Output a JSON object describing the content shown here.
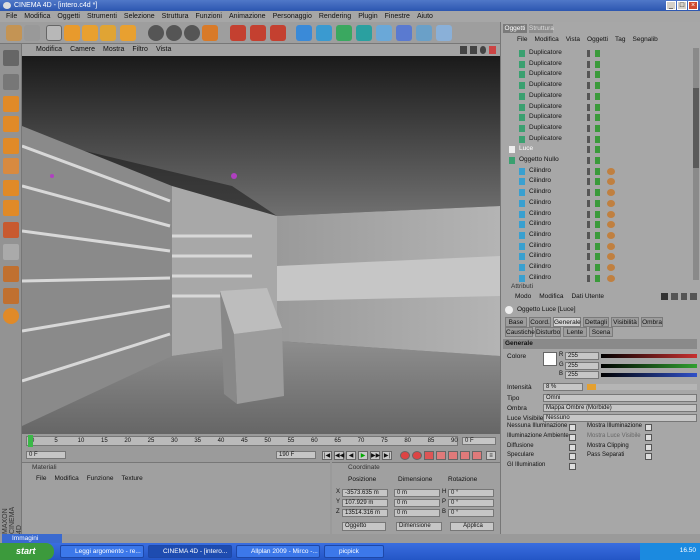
{
  "window": {
    "title": "CINEMA 4D - [intero.c4d *]"
  },
  "menu": [
    "File",
    "Modifica",
    "Oggetti",
    "Strumenti",
    "Selezione",
    "Struttura",
    "Funzioni",
    "Animazione",
    "Personaggio",
    "Rendering",
    "Plugin",
    "Finestre",
    "Aiuto"
  ],
  "viewport_menu": [
    "Modifica",
    "Camere",
    "Mostra",
    "Filtro",
    "Vista"
  ],
  "object_manager": {
    "tabs": [
      "Oggetti",
      "Struttura"
    ],
    "menu": [
      "File",
      "Modifica",
      "Vista",
      "Oggetti",
      "Tag",
      "Segnalib"
    ],
    "rows": [
      "Duplicatore",
      "Duplicatore",
      "Duplicatore",
      "Duplicatore",
      "Duplicatore",
      "Duplicatore",
      "Duplicatore",
      "Duplicatore",
      "Duplicatore",
      "Luce",
      "Oggetto Nullo",
      "Cilindro",
      "Cilindro",
      "Cilindro",
      "Cilindro",
      "Cilindro",
      "Cilindro",
      "Cilindro",
      "Cilindro",
      "Cilindro",
      "Cilindro",
      "Cilindro"
    ]
  },
  "attributes": {
    "tab": "Attributi",
    "menu": [
      "Modo",
      "Modifica",
      "Dati Utente"
    ],
    "object_name": "Oggetto Luce [Luce]",
    "tabs_row1": [
      "Base",
      "Coord.",
      "Generale",
      "Dettagli",
      "Visibilità",
      "Ombra"
    ],
    "tabs_row2": [
      "Caustiche",
      "Disturbo",
      "Lente",
      "Scena"
    ],
    "section": "Generale",
    "color_label": "Colore",
    "rgb": [
      {
        "ch": "R",
        "v": "255"
      },
      {
        "ch": "G",
        "v": "255"
      },
      {
        "ch": "B",
        "v": "255"
      }
    ],
    "intensity_label": "Intensità",
    "intensity": "8 %",
    "type_label": "Tipo",
    "type": "Omni",
    "shadow_label": "Ombra",
    "shadow": "Mappa Ombre (Morbide)",
    "visible_label": "Luce Visibile",
    "visible": "Nessuno",
    "checks_left": [
      "Nessuna Illuminazione",
      "Illuminazione Ambiente",
      "Diffusione",
      "Speculare",
      "GI Illumination"
    ],
    "checks_right": [
      "Mostra Illuminazione",
      "Mostra Luce Visibile",
      "Mostra Clipping",
      "Pass Separati"
    ]
  },
  "timeline": {
    "ticks": [
      "0",
      "5",
      "10",
      "15",
      "20",
      "25",
      "30",
      "35",
      "40",
      "45",
      "50",
      "55",
      "60",
      "65",
      "70",
      "75",
      "80",
      "85",
      "90"
    ],
    "start": "0 F",
    "end": "190 F",
    "current": "0 F"
  },
  "materials": {
    "tab": "Materiali",
    "menu": [
      "File",
      "Modifica",
      "Funzione",
      "Texture"
    ]
  },
  "coordinates": {
    "tab": "Coordinate",
    "headers": [
      "Posizione",
      "Dimensione",
      "Rotazione"
    ],
    "rows": [
      {
        "axis": "X",
        "pos": "-3573.635 m",
        "dim": "0 m",
        "rotlabel": "H",
        "rot": "0 °"
      },
      {
        "axis": "Y",
        "pos": "107.929 m",
        "dim": "0 m",
        "rotlabel": "P",
        "rot": "0 °"
      },
      {
        "axis": "Z",
        "pos": "13514.316 m",
        "dim": "0 m",
        "rotlabel": "B",
        "rot": "0 °"
      }
    ],
    "mode1": "Oggetto",
    "mode2": "Dimensione",
    "apply": "Applica"
  },
  "logo": "MAXON CINEMA 4D",
  "immagini_label": "Immagini",
  "taskbar": {
    "start": "start",
    "tasks": [
      "Leggi argomento - re...",
      "CINEMA 4D - [intero...",
      "Allplan 2009 - Mirco -...",
      "picpick"
    ],
    "clock": "16.50"
  },
  "colors": {
    "accent": "#2c56b0",
    "panel": "#a7a7a7"
  }
}
